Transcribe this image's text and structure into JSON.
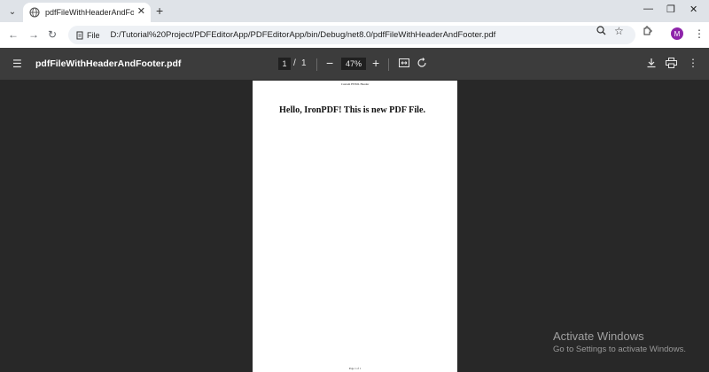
{
  "browser": {
    "tab": {
      "title": "pdfFileWithHeaderAndFooter.pdf"
    },
    "address": {
      "scheme_label": "File",
      "url": "D:/Tutorial%20Project/PDFEditorApp/PDFEditorApp/bin/Debug/net8.0/pdfFileWithHeaderAndFooter.pdf"
    },
    "avatar_initial": "M"
  },
  "pdf_viewer": {
    "title": "pdfFileWithHeaderAndFooter.pdf",
    "current_page": "1",
    "page_separator": "/",
    "total_pages": "1",
    "zoom": "47%"
  },
  "document": {
    "header_text": "Custom HTML Header",
    "heading": "Hello, IronPDF! This is new PDF File.",
    "footer_text": "Page 1 of 1"
  },
  "watermark": {
    "line1": "Activate Windows",
    "line2": "Go to Settings to activate Windows."
  },
  "icons": [
    "tab-search-icon",
    "globe-icon",
    "close-icon",
    "plus-icon",
    "minimize-icon",
    "restore-icon",
    "back-icon",
    "forward-icon",
    "reload-icon",
    "file-icon",
    "zoom-icon",
    "star-icon",
    "extensions-icon",
    "more-icon",
    "hamburger-icon",
    "fit-page-icon",
    "rotate-icon",
    "download-icon",
    "print-icon"
  ],
  "colors": {
    "avatar": "#8e24aa",
    "pdf_toolbar": "#3c3c3c",
    "viewer_background": "#282828"
  }
}
